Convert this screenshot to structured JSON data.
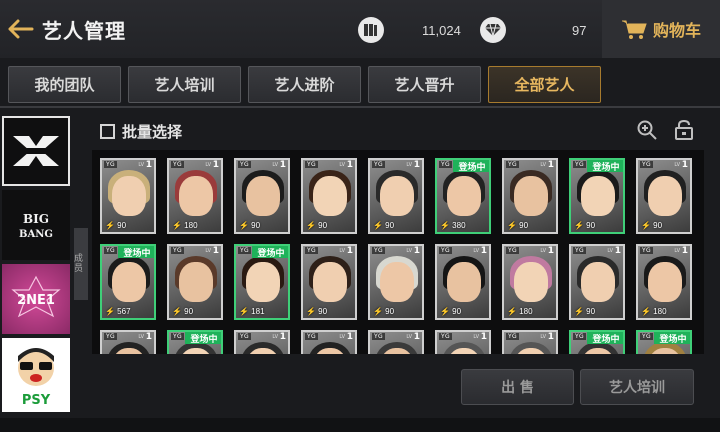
{
  "header": {
    "title": "艺人管理",
    "resource1_value": "11,024",
    "resource2_value": "97",
    "shop_label": "购物车"
  },
  "tabs": [
    {
      "label": "我的团队"
    },
    {
      "label": "艺人培训"
    },
    {
      "label": "艺人进阶"
    },
    {
      "label": "艺人晋升"
    },
    {
      "label": "全部艺人"
    }
  ],
  "sidebar": {
    "groups": [
      {
        "name": "YG"
      },
      {
        "name": "BIG BANG"
      },
      {
        "name": "2NE1"
      },
      {
        "name": "PSY"
      }
    ],
    "handle_text": "成 员"
  },
  "batch_select_label": "批量选择",
  "cards": [
    {
      "level": "1",
      "power": "90",
      "status": "",
      "hair": "#c9b07a"
    },
    {
      "level": "1",
      "power": "180",
      "status": "",
      "hair": "#9a3b3b"
    },
    {
      "level": "1",
      "power": "90",
      "status": "",
      "hair": "#1c1c1c"
    },
    {
      "level": "1",
      "power": "90",
      "status": "",
      "hair": "#3a2418"
    },
    {
      "level": "1",
      "power": "90",
      "status": "",
      "hair": "#2a2a2a"
    },
    {
      "level": "1",
      "power": "380",
      "status": "登场中",
      "hair": "#222"
    },
    {
      "level": "1",
      "power": "90",
      "status": "",
      "hair": "#3a2a22"
    },
    {
      "level": "1",
      "power": "90",
      "status": "登场中",
      "hair": "#1a1a1a"
    },
    {
      "level": "1",
      "power": "90",
      "status": "",
      "hair": "#202020"
    },
    {
      "level": "1",
      "power": "567",
      "status": "登场中",
      "hair": "#1b1b1b"
    },
    {
      "level": "1",
      "power": "90",
      "status": "",
      "hair": "#5a3a2a"
    },
    {
      "level": "1",
      "power": "181",
      "status": "登场中",
      "hair": "#2a1a12"
    },
    {
      "level": "1",
      "power": "90",
      "status": "",
      "hair": "#2e2018"
    },
    {
      "level": "1",
      "power": "90",
      "status": "",
      "hair": "#d8d8d0"
    },
    {
      "level": "1",
      "power": "90",
      "status": "",
      "hair": "#151515"
    },
    {
      "level": "1",
      "power": "180",
      "status": "",
      "hair": "#c07aa0"
    },
    {
      "level": "1",
      "power": "90",
      "status": "",
      "hair": "#2a2a2a"
    },
    {
      "level": "1",
      "power": "180",
      "status": "",
      "hair": "#1a1a1a"
    },
    {
      "level": "1",
      "power": "",
      "status": "",
      "hair": "#222"
    },
    {
      "level": "1",
      "power": "",
      "status": "登场中",
      "hair": "#333"
    },
    {
      "level": "1",
      "power": "",
      "status": "",
      "hair": "#2a2a2a"
    },
    {
      "level": "1",
      "power": "",
      "status": "",
      "hair": "#222"
    },
    {
      "level": "1",
      "power": "",
      "status": "",
      "hair": "#3a3a3a"
    },
    {
      "level": "1",
      "power": "",
      "status": "",
      "hair": "#555"
    },
    {
      "level": "1",
      "power": "",
      "status": "",
      "hair": "#555"
    },
    {
      "level": "1",
      "power": "",
      "status": "登场中",
      "hair": "#333"
    },
    {
      "level": "1",
      "power": "",
      "status": "登场中",
      "hair": "#a08040"
    }
  ],
  "card_brand": "YG",
  "card_level_tag": "LV",
  "buttons": {
    "sell_label": "出 售",
    "train_label": "艺人培训"
  }
}
